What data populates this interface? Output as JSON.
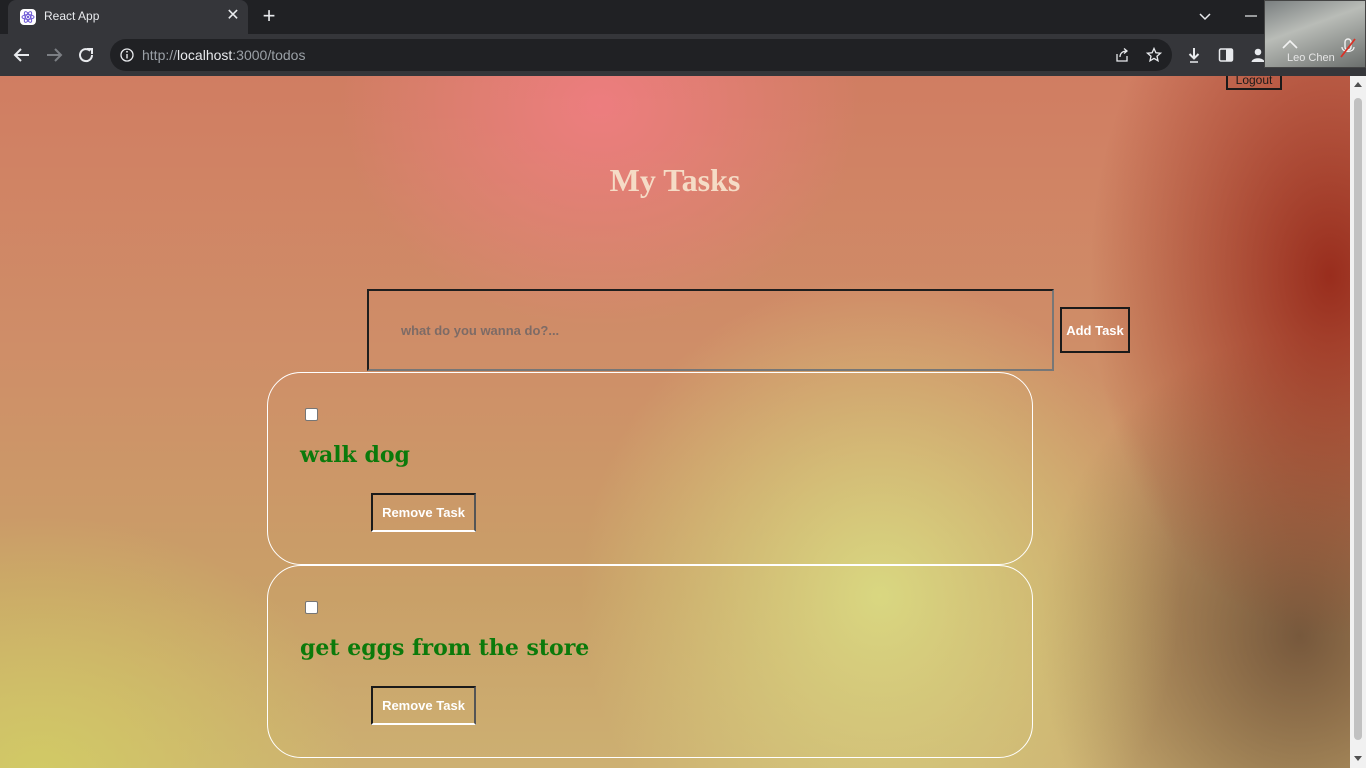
{
  "browser": {
    "tab_title": "React App",
    "url_prefix": "http://",
    "url_host": "localhost",
    "url_path": ":3000/todos"
  },
  "webcam": {
    "name": "Leo Chen"
  },
  "app": {
    "logout_label": "Logout",
    "title": "My Tasks",
    "input": {
      "value": "",
      "placeholder": "what do you wanna do?..."
    },
    "add_button_label": "Add Task",
    "tasks": [
      {
        "text": "walk dog",
        "checked": false,
        "remove_label": "Remove Task"
      },
      {
        "text": "get eggs from the store",
        "checked": false,
        "remove_label": "Remove Task"
      }
    ]
  },
  "colors": {
    "task_text": "#0b7a0b",
    "title_text": "#f5dcc6",
    "card_border": "#ffffff"
  }
}
